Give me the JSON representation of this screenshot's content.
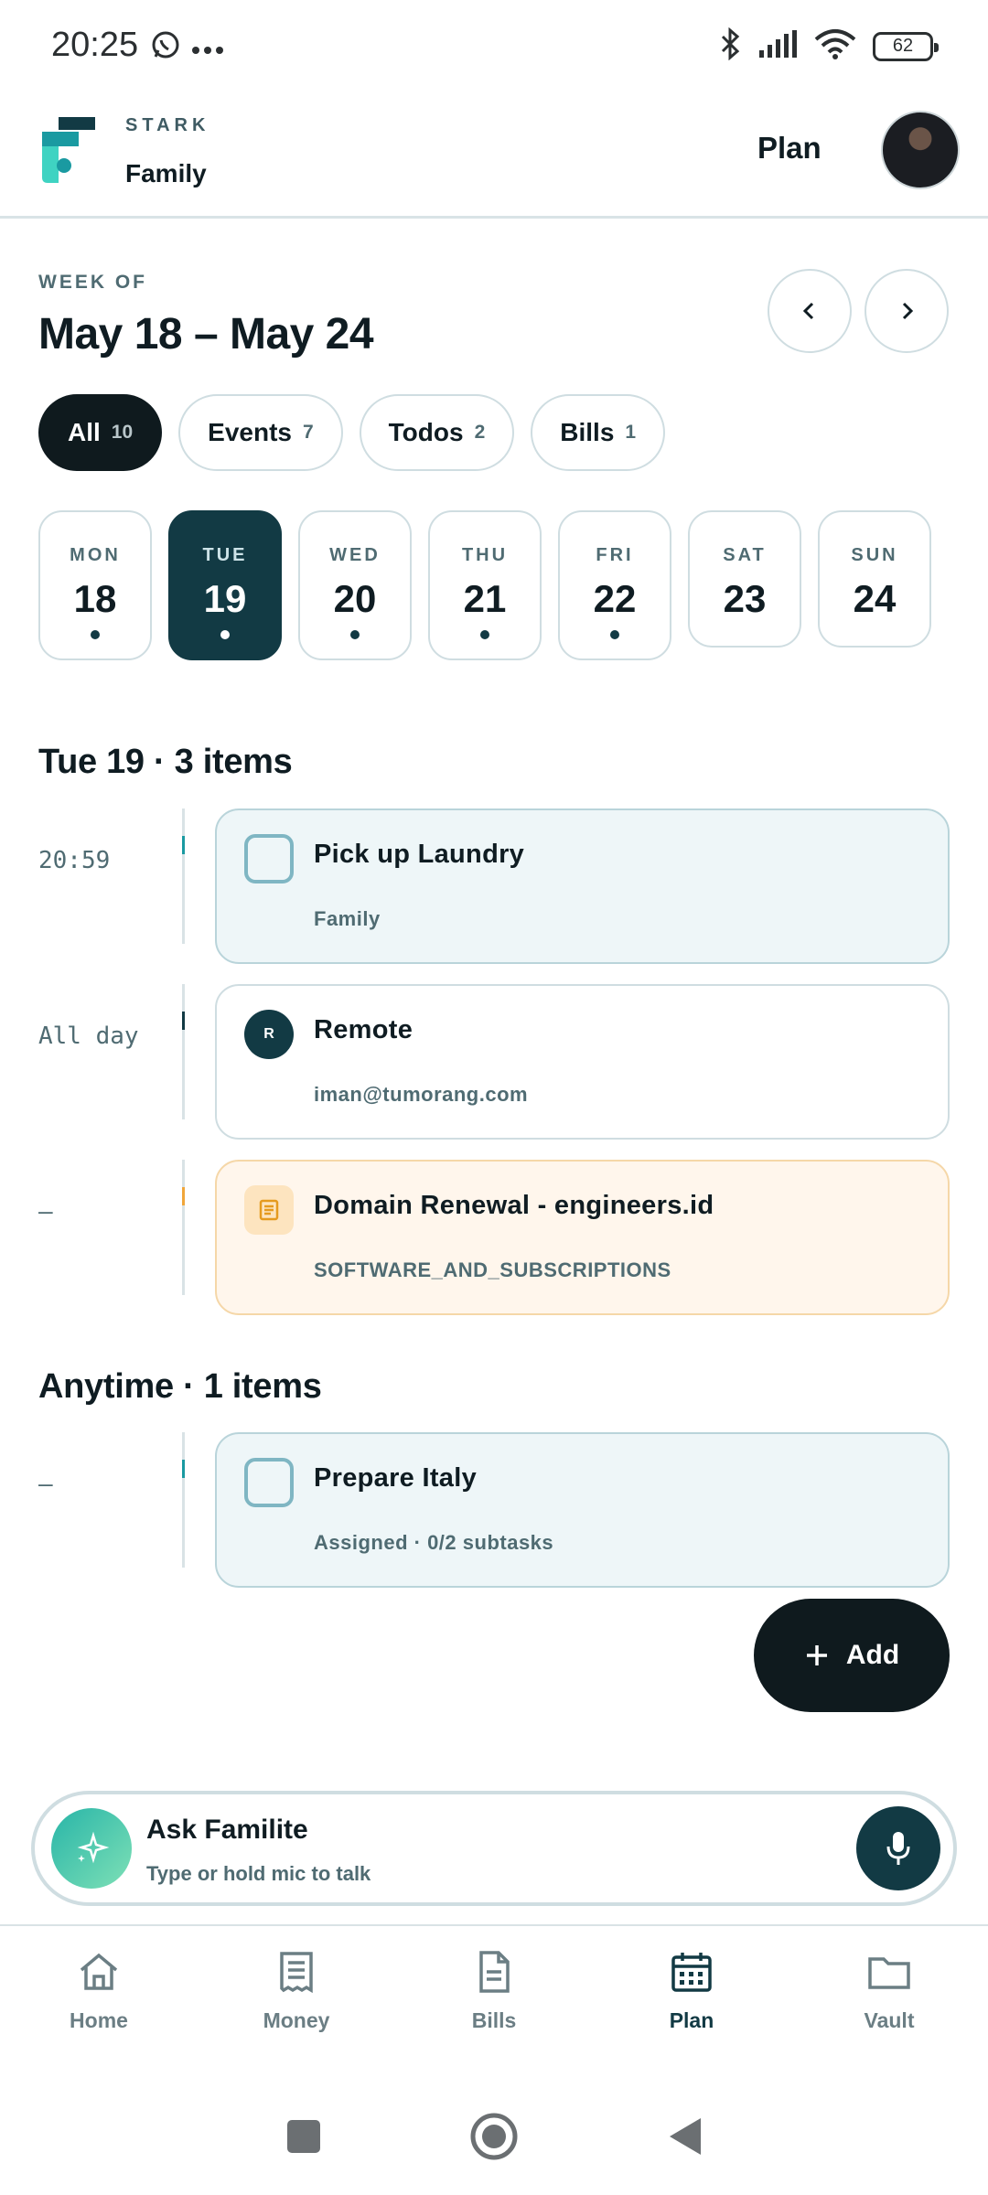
{
  "status_bar": {
    "time": "20:25",
    "battery": "62"
  },
  "header": {
    "brand_small": "STARK",
    "brand_name": "Family",
    "title": "Plan"
  },
  "week": {
    "label": "WEEK OF",
    "range": "May 18 – May 24"
  },
  "filters": [
    {
      "label": "All",
      "count": "10",
      "active": true
    },
    {
      "label": "Events",
      "count": "7"
    },
    {
      "label": "Todos",
      "count": "2"
    },
    {
      "label": "Bills",
      "count": "1"
    }
  ],
  "days": [
    {
      "name": "MON",
      "num": "18",
      "dot": true
    },
    {
      "name": "TUE",
      "num": "19",
      "dot": true,
      "active": true
    },
    {
      "name": "WED",
      "num": "20",
      "dot": true
    },
    {
      "name": "THU",
      "num": "21",
      "dot": true
    },
    {
      "name": "FRI",
      "num": "22",
      "dot": true
    },
    {
      "name": "SAT",
      "num": "23",
      "dot": false
    },
    {
      "name": "SUN",
      "num": "24",
      "dot": false
    }
  ],
  "sections": {
    "day": {
      "title": "Tue 19 · 3 items",
      "items": [
        {
          "time": "20:59",
          "title": "Pick up Laundry",
          "subtitle": "Family",
          "kind": "todo"
        },
        {
          "time": "All day",
          "title": "Remote",
          "subtitle": "iman@tumorang.com",
          "kind": "event",
          "avatar_letter": "R"
        },
        {
          "time": "–",
          "title": "Domain Renewal - engineers.id",
          "subtitle": "SOFTWARE_AND_SUBSCRIPTIONS",
          "kind": "bill"
        }
      ]
    },
    "anytime": {
      "title": "Anytime · 1 items",
      "items": [
        {
          "time": "–",
          "title": "Prepare Italy",
          "subtitle": "Assigned · 0/2 subtasks",
          "kind": "todo"
        }
      ]
    }
  },
  "fab": {
    "label": "Add"
  },
  "ask": {
    "title": "Ask Familite",
    "placeholder": "Type or hold mic to talk"
  },
  "bottom_nav": [
    {
      "label": "Home",
      "icon": "home-icon"
    },
    {
      "label": "Money",
      "icon": "receipt-icon"
    },
    {
      "label": "Bills",
      "icon": "document-icon"
    },
    {
      "label": "Plan",
      "icon": "calendar-icon",
      "active": true
    },
    {
      "label": "Vault",
      "icon": "folder-icon"
    }
  ],
  "colors": {
    "accent": "#123a44",
    "todo_bg": "#eef6f8",
    "bill_bg": "#fff6ec",
    "dark": "#0f1a1e"
  }
}
